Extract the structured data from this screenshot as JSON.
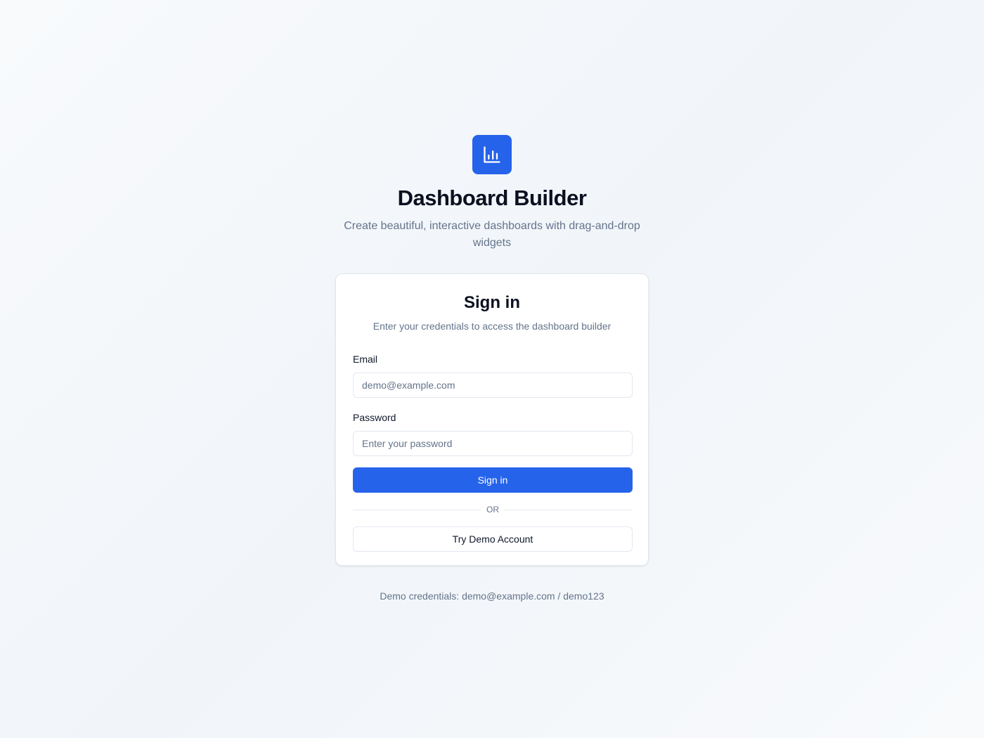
{
  "brand": {
    "logo_icon": "bar-chart-icon",
    "title": "Dashboard Builder",
    "subtitle": "Create beautiful, interactive dashboards with drag-and-drop widgets"
  },
  "signin_card": {
    "title": "Sign in",
    "description": "Enter your credentials to access the dashboard builder",
    "email": {
      "label": "Email",
      "placeholder": "demo@example.com",
      "value": ""
    },
    "password": {
      "label": "Password",
      "placeholder": "Enter your password",
      "value": ""
    },
    "submit_label": "Sign in",
    "divider_label": "Or",
    "demo_button_label": "Try Demo Account"
  },
  "footer": {
    "demo_credentials": "Demo credentials: demo@example.com / demo123"
  },
  "colors": {
    "accent": "#2563eb",
    "muted_text": "#64748b",
    "border": "#e2e8f0"
  }
}
